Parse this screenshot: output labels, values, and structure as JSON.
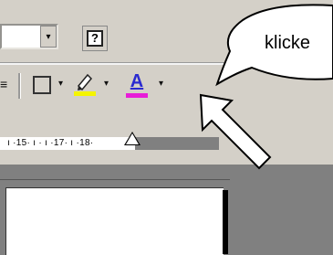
{
  "toolbar": {
    "font_combo_value": "",
    "combo_arrow": "▾",
    "help_glyph": "?",
    "align_glyph": "≡",
    "dropdown_glyph": "▾",
    "font_color_letter": "A"
  },
  "ruler": {
    "text": "ı ·15· ı · ı ·17· ı ·18·"
  },
  "callout": {
    "text": "klicke"
  },
  "icons": {
    "help": "help-icon",
    "align": "align-right-icon",
    "border": "border-icon",
    "highlight": "highlighter-icon",
    "font_color": "font-color-icon",
    "pointer": "arrow-pointer-icon"
  },
  "colors": {
    "toolbar_bg": "#d4d0c8",
    "highlight_bar": "#f4f400",
    "font_color_bar": "#e81dd8",
    "font_color_letter": "#2a2ad0"
  }
}
